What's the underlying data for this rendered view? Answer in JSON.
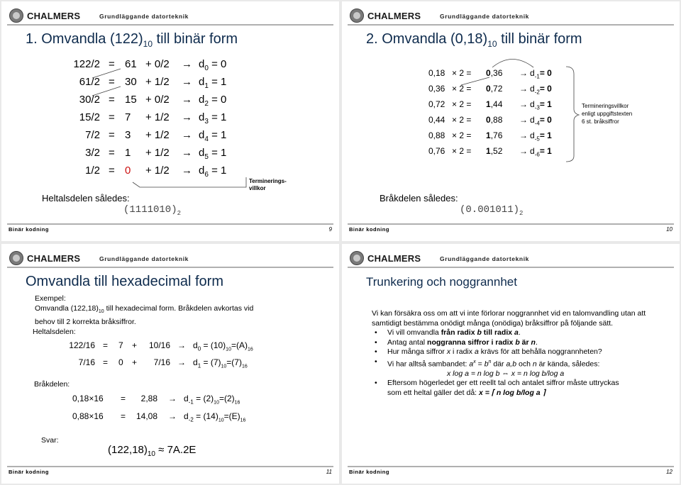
{
  "header": {
    "brand": "CHALMERS",
    "course": "Grundläggande datorteknik"
  },
  "footer": {
    "label": "Binär kodning"
  },
  "slides": [
    {
      "page": "9",
      "title_pre": "1. Omvandla (122)",
      "title_sub": "10",
      "title_post": " till binär form",
      "rows": [
        {
          "div": "122/2",
          "eq": "=",
          "q": "61",
          "rem": "+ 0/2",
          "d": "d",
          "di": "0",
          "val": "= 0"
        },
        {
          "div": "61/2",
          "eq": "=",
          "q": "30",
          "rem": "+ 1/2",
          "d": "d",
          "di": "1",
          "val": "= 1"
        },
        {
          "div": "30/2",
          "eq": "=",
          "q": "15",
          "rem": "+ 0/2",
          "d": "d",
          "di": "2",
          "val": "= 0"
        },
        {
          "div": "15/2",
          "eq": "=",
          "q": "7",
          "rem": "+ 1/2",
          "d": "d",
          "di": "3",
          "val": "= 1"
        },
        {
          "div": "7/2",
          "eq": "=",
          "q": "3",
          "rem": "+ 1/2",
          "d": "d",
          "di": "4",
          "val": "= 1"
        },
        {
          "div": "3/2",
          "eq": "=",
          "q": "1",
          "rem": "+ 1/2",
          "d": "d",
          "di": "5",
          "val": "= 1"
        },
        {
          "div": "1/2",
          "eq": "=",
          "q": "0",
          "rem": "+ 1/2",
          "d": "d",
          "di": "6",
          "val": "= 1"
        }
      ],
      "arrow": "→",
      "note_line1": "Terminerings-",
      "note_line2": "villkor",
      "result_label": "Heltalsdelen således:",
      "result_value": "(1111010)",
      "result_sub": "2"
    },
    {
      "page": "10",
      "title_pre": "2. Omvandla (0,18)",
      "title_sub": "10",
      "title_post": " till binär form",
      "rows": [
        {
          "a": "0,18",
          "op": "× 2 =",
          "ri": "0",
          "rf": ",36",
          "d": "d",
          "di": "-1",
          "val": "= 0"
        },
        {
          "a": "0,36",
          "op": "× 2 =",
          "ri": "0",
          "rf": ",72",
          "d": "d",
          "di": "-2",
          "val": "= 0"
        },
        {
          "a": "0,72",
          "op": "× 2 =",
          "ri": "1",
          "rf": ",44",
          "d": "d",
          "di": "-3",
          "val": "= 1"
        },
        {
          "a": "0,44",
          "op": "× 2 =",
          "ri": "0",
          "rf": ",88",
          "d": "d",
          "di": "-4",
          "val": "= 0"
        },
        {
          "a": "0,88",
          "op": "× 2 =",
          "ri": "1",
          "rf": ",76",
          "d": "d",
          "di": "-5",
          "val": "= 1"
        },
        {
          "a": "0,76",
          "op": "× 2 =",
          "ri": "1",
          "rf": ",52",
          "d": "d",
          "di": "-6",
          "val": "= 1"
        }
      ],
      "arrow": "→",
      "note_lines": [
        "Termineringsvillkor",
        "enligt uppgiftstexten",
        "6 st. bråksiffror"
      ],
      "result_label": "Bråkdelen således:",
      "result_value": "(0.001011)",
      "result_sub": "2"
    },
    {
      "page": "11",
      "title": "Omvandla till hexadecimal form",
      "example_label": "Exempel:",
      "example_pre": "Omvandla (122,18)",
      "example_sub": "10",
      "example_post": " till hexadecimal form. Bråkdelen avkortas vid",
      "example_line2": "behov till 2 korrekta bråksiffror.",
      "int_label": "Heltalsdelen:",
      "int_rows": [
        {
          "div": "122/16",
          "eq": "=",
          "q": "7",
          "plus": "+",
          "rem": "10/16",
          "d": "d",
          "di": "0",
          "v1": "= (10)",
          "s1": "10",
          "v2": "=(A)",
          "s2": "16"
        },
        {
          "div": "7/16",
          "eq": "=",
          "q": "0",
          "plus": "+",
          "rem": "7/16",
          "d": "d",
          "di": "1",
          "v1": "= (7)",
          "s1": "10",
          "v2": "=(7)",
          "s2": "16"
        }
      ],
      "frac_label": "Bråkdelen:",
      "frac_rows": [
        {
          "mul": "0,18×16",
          "eq": "=",
          "res": "2,88",
          "d": "d",
          "di": "-1",
          "v1": "= (2)",
          "s1": "10",
          "v2": "=(2)",
          "s2": "16"
        },
        {
          "mul": "0,88×16",
          "eq": "=",
          "res": "14,08",
          "d": "d",
          "di": "-2",
          "v1": "= (14)",
          "s1": "10",
          "v2": "=(E)",
          "s2": "16"
        }
      ],
      "arrow": "→",
      "answer_label": "Svar:",
      "answer_pre": "(122,18)",
      "answer_sub": "10",
      "answer_post": " ≈ 7A.2E"
    },
    {
      "page": "12",
      "title": "Trunkering och noggrannhet",
      "intro": "Vi kan försäkra oss om att vi inte förlorar noggrannhet vid en talomvandling utan att samtidigt bestämma onödigt många (onödiga) bråksiffror på följande sätt.",
      "b1_pre": "Vi vill omvandla ",
      "b1_bold1": "från radix ",
      "b1_bi1": "b",
      "b1_bold2": " till radix ",
      "b1_bi2": "a",
      "b1_post": ".",
      "b2_pre": "Antag antal ",
      "b2_bold": "noggranna siffror i radix ",
      "b2_bi1": "b",
      "b2_bold2": " är ",
      "b2_bi2": "n",
      "b2_post": ".",
      "b3_pre": "Hur många siffror ",
      "b3_x": "x",
      "b3_mid": " i radix ",
      "b3_a": "a",
      "b3_post": " krävs för att behålla noggrannheten?",
      "b4_pre": "Vi har alltså sambandet: ",
      "b4_a": "a",
      "b4_x": "x",
      "b4_eq": " = ",
      "b4_b": "b",
      "b4_n": "n",
      "b4_post_1": " där ",
      "b4_ab": "a,b",
      "b4_post_2": " och ",
      "b4_nn": "n",
      "b4_post_3": " är kända, således:",
      "formula": "x log a = n log b ⇔ x = n log b/log a",
      "b5_line1": "Eftersom högerledet ger ett reellt tal och antalet siffror måste uttryckas",
      "b5_line2_pre": "som ett heltal gäller det då: ",
      "b5_formula": "x = ⌈ n log b/log a ⌉"
    }
  ]
}
